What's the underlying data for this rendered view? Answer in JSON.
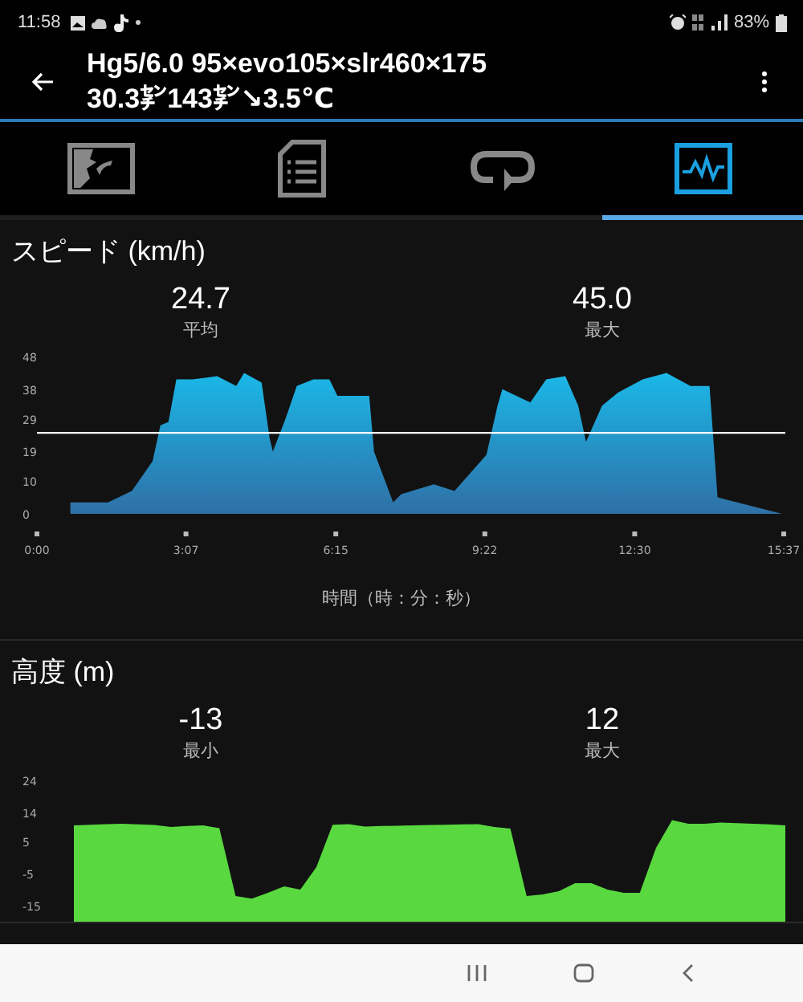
{
  "status_bar": {
    "time": "11:58",
    "battery": "83%"
  },
  "header": {
    "title": "Hg5/6.0 95×evo105×slr460×175",
    "subtitle": "30.3㌢143㌢↘3.5℃"
  },
  "tabs": [
    {
      "selected": false
    },
    {
      "selected": false
    },
    {
      "selected": false
    },
    {
      "selected": true
    }
  ],
  "sections": [
    {
      "title": "スピード (km/h)",
      "stats": [
        {
          "value": "24.7",
          "label": "平均"
        },
        {
          "value": "45.0",
          "label": "最大"
        }
      ],
      "chart_data": {
        "type": "area",
        "xlabel": "時間（時：分：秒）",
        "x": [
          42,
          89,
          119,
          145,
          155,
          165,
          175,
          195,
          226,
          250,
          260,
          282,
          292,
          296,
          312,
          326,
          347,
          367,
          377,
          417,
          423,
          447,
          457,
          498,
          524,
          564,
          578,
          584,
          619,
          639,
          663,
          679,
          689,
          709,
          729,
          760,
          790,
          820,
          844,
          854,
          935
        ],
        "series": [
          {
            "color": "#1ab8e8",
            "values": [
              3.5,
              3.5,
              7,
              16,
              27,
              28,
              41,
              41,
              42,
              39,
              43,
              40,
              23,
              19,
              29,
              39,
              41,
              41,
              36,
              36,
              19,
              3.5,
              6,
              9,
              7,
              18,
              33,
              38,
              34,
              41,
              42,
              33,
              22,
              33,
              37,
              41,
              43,
              39,
              39,
              5,
              0
            ]
          }
        ],
        "xlim": [
          0,
          937
        ],
        "ylim": [
          0,
          48
        ],
        "yticks": [
          0,
          10,
          19,
          29,
          38,
          48
        ],
        "xticks": [
          {
            "value": 0,
            "label": "0:00"
          },
          {
            "value": 187,
            "label": "3:07"
          },
          {
            "value": 375,
            "label": "6:15"
          },
          {
            "value": 562,
            "label": "9:22"
          },
          {
            "value": 750,
            "label": "12:30"
          },
          {
            "value": 937,
            "label": "15:37"
          }
        ],
        "ref_lines": [
          {
            "axis": "y",
            "value": 24.7
          }
        ]
      }
    },
    {
      "title": "高度 (m)",
      "stats": [
        {
          "value": "-13",
          "label": "最小"
        },
        {
          "value": "12",
          "label": "最大"
        }
      ],
      "chart_data": {
        "type": "area",
        "categories": [
          null,
          null,
          null,
          null,
          null,
          null,
          null,
          null,
          null,
          null,
          null,
          null,
          null,
          null,
          null,
          null,
          null,
          null,
          null,
          null,
          null,
          null,
          null,
          null,
          null,
          null,
          null,
          null,
          null,
          null,
          null,
          null,
          null,
          null,
          null,
          null,
          null,
          null,
          null,
          null,
          null,
          null,
          null,
          null,
          null
        ],
        "series": [
          {
            "color": "#5ad840",
            "values": [
              10,
              10.2,
              10.4,
              10.5,
              10.3,
              10.1,
              9.5,
              9.8,
              10,
              9.1,
              -12,
              -12.8,
              -11,
              -9,
              -10,
              -3,
              10.2,
              10.4,
              9.6,
              9.8,
              9.9,
              10,
              10.1,
              10.2,
              10.3,
              10.4,
              9.5,
              9,
              -12,
              -11.5,
              -10.5,
              -8,
              -8,
              -10,
              -11,
              -11,
              3,
              11.6,
              10.5,
              10.5,
              10.9,
              10.7,
              10.5,
              10.3,
              10
            ]
          }
        ],
        "ylim": [
          -15,
          24
        ],
        "yticks": [
          {
            "value": 24,
            "label": "24"
          },
          {
            "value": 14,
            "label": "14"
          },
          {
            "value": 5,
            "label": "5"
          },
          {
            "value": -5,
            "label": "-5"
          },
          {
            "value": -15,
            "label": "-15"
          }
        ]
      }
    }
  ]
}
